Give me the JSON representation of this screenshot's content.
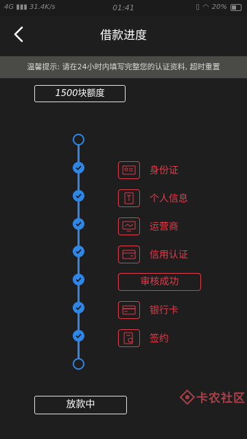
{
  "status_bar": {
    "network": "4G",
    "speed": "31.4K/s",
    "time": "01:41",
    "battery": "20%"
  },
  "nav": {
    "title": "借款进度"
  },
  "notice": {
    "text": "温馨提示: 请在24小时内填写完整您的认证资料, 超时重置"
  },
  "quota": {
    "amount": "1500",
    "suffix": "块额度"
  },
  "steps": [
    {
      "label": "身份证",
      "icon": "id-card-icon"
    },
    {
      "label": "个人信息",
      "icon": "personal-info-icon"
    },
    {
      "label": "运营商",
      "icon": "carrier-icon"
    },
    {
      "label": "信用认证",
      "icon": "credit-card-icon"
    },
    {
      "label": "审核成功",
      "icon": ""
    },
    {
      "label": "银行卡",
      "icon": "bank-card-icon"
    },
    {
      "label": "签约",
      "icon": "contract-icon"
    }
  ],
  "bottom_status": {
    "label": "放款中"
  },
  "watermark": {
    "text": "卡农社区"
  },
  "colors": {
    "background": "#1e1e1e",
    "accent_red": "#e23b4a",
    "timeline_blue": "#2e86e6",
    "notice_bg": "#4a4a47"
  }
}
